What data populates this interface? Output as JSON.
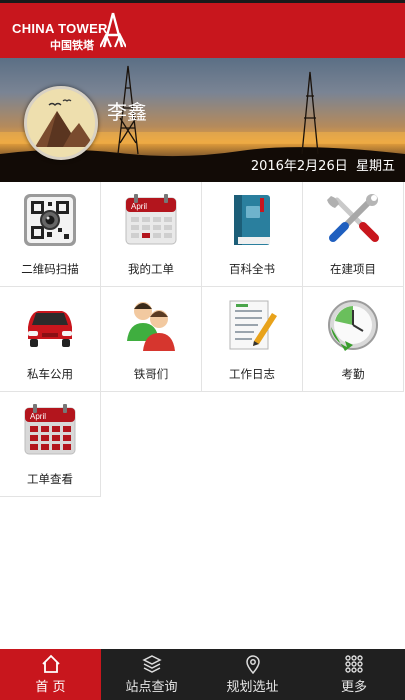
{
  "brand": {
    "name_en": "CHINA TOWER",
    "name_cn": "中国铁塔",
    "color": "#c8161d"
  },
  "profile": {
    "name": "李鑫",
    "date": "2016年2月26日",
    "weekday": "星期五"
  },
  "grid": [
    {
      "label": "二维码扫描",
      "icon": "qr-code-scan-icon"
    },
    {
      "label": "我的工单",
      "icon": "calendar-icon",
      "icon_text": "April"
    },
    {
      "label": "百科全书",
      "icon": "book-icon"
    },
    {
      "label": "在建项目",
      "icon": "tools-icon"
    },
    {
      "label": "私车公用",
      "icon": "car-icon"
    },
    {
      "label": "铁哥们",
      "icon": "people-icon"
    },
    {
      "label": "工作日志",
      "icon": "notepad-icon"
    },
    {
      "label": "考勤",
      "icon": "clock-icon"
    },
    {
      "label": "工单查看",
      "icon": "calendar-grid-icon",
      "icon_text": "April"
    }
  ],
  "nav": [
    {
      "label": "首 页",
      "icon": "home-icon",
      "active": true
    },
    {
      "label": "站点查询",
      "icon": "layers-icon",
      "active": false
    },
    {
      "label": "规划选址",
      "icon": "location-pin-icon",
      "active": false
    },
    {
      "label": "更多",
      "icon": "more-grid-icon",
      "active": false
    }
  ]
}
